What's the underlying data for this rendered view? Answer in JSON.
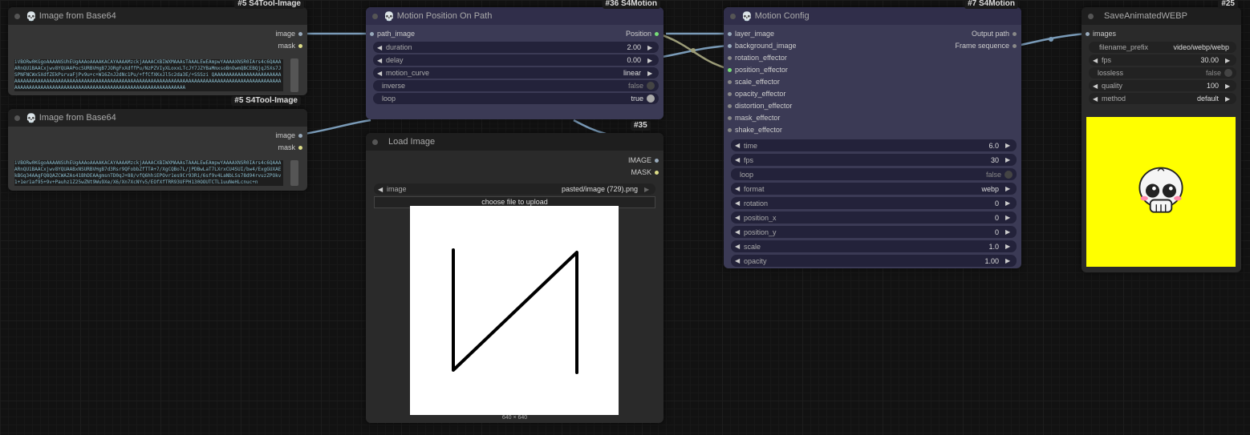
{
  "nodes": {
    "img64_a": {
      "title": "Image from Base64",
      "badge": "#5 S4Tool-Image",
      "outputs": [
        "image",
        "mask"
      ],
      "base64": "iVBORw0KGgoAAAANSUhEUgAAAoAAAAKACAYAAAAMzckjAAAACXBIWXMAAAsTAAALEwEAmpwYAAAAXNSR0IArs4c6QAAAARnQU1BAACxjwv8YQUAAPocSURBVHgB7JORgFxXdffPu/NzPZVIyXLoxxLTcJY7JZYBaMmxsoBnOwmQBCEBQjqJ5Xs7JSPNFNCWx5XdfZEkPsrvaFjPv9u+c+W16ZnJ2dNc1Pu/+ffCfXKxJl5c2da3E/+SSSzi QAAAAAAAAAAAAAAAAAAAAAAAAAAAAAAAAAAAAAAAAAAAAAAAAAAAAAAAAAAAAAAAAAAAAAAAAAAAAAAAAAAAAAAAAAAAAAAAAAAAAAAAAAAAAAAAAAAAAAAAAAAAAAAAAAAAAAAAAAAAAAAAAAAAAAAAAAAAAAAAAAAAAAAAAAAAAAA"
    },
    "img64_b": {
      "title": "Image from Base64",
      "badge": "#5 S4Tool-Image",
      "outputs": [
        "image",
        "mask"
      ],
      "base64": "iVBORw0KGgoAAAANSUhEUgAAAoAAAAKACAYAAAAMzckjAAAACXBIWXMAAAsTAAALEwEAmpwYAAAAXNSR0IArs4c6QAAAARnQU1BAACxjwv8YQUAABxNSURBVHgB7d3Rsr9QFobbZfTTA+7/XgCQBo7L/jPDBwLaT7LXrxCU4SUI/bw4/ExgGUXAEkBGq34AAgFQ8QAZCWAZAs41BhDEAAgmsnTD0qJ+88/vfQ6hhiEPOvr1es9Cr93Ri/6sf9v4LaNbLSs78d94rvuzZPOkv1+1er1af95+9v+Pauhz1Z25wZNt9Wu9Xe/X6/Xn7XcNYv5/EOfXfTRR93UFPH130OOUTCTL1uuNeHLcnuc+n"
    },
    "motion_path": {
      "title": "Motion Position On Path",
      "badge": "#36 S4Motion",
      "badge2": "#35",
      "inputs": [
        "path_image"
      ],
      "outputs": [
        "Position"
      ],
      "widgets": [
        {
          "label": "duration",
          "value": "2.00"
        },
        {
          "label": "delay",
          "value": "0.00"
        },
        {
          "label": "motion_curve",
          "value": "linear"
        },
        {
          "label": "inverse",
          "value": "false"
        },
        {
          "label": "loop",
          "value": "true"
        }
      ]
    },
    "load_image": {
      "title": "Load Image",
      "outputs": [
        "IMAGE",
        "MASK"
      ],
      "image_label": "image",
      "image_value": "pasted/image (729).png",
      "upload_label": "choose file to upload",
      "dims": "640 × 640"
    },
    "motion_config": {
      "title": "Motion Config",
      "badge": "#7 S4Motion",
      "inputs": [
        "layer_image",
        "background_image",
        "rotation_effector",
        "position_effector",
        "scale_effector",
        "opacity_effector",
        "distortion_effector",
        "mask_effector",
        "shake_effector"
      ],
      "outputs": [
        "Output path",
        "Frame sequence"
      ],
      "widgets": [
        {
          "label": "time",
          "value": "6.0"
        },
        {
          "label": "fps",
          "value": "30"
        },
        {
          "label": "loop",
          "value": "false"
        },
        {
          "label": "format",
          "value": "webp"
        },
        {
          "label": "rotation",
          "value": "0"
        },
        {
          "label": "position_x",
          "value": "0"
        },
        {
          "label": "position_y",
          "value": "0"
        },
        {
          "label": "scale",
          "value": "1.0"
        },
        {
          "label": "opacity",
          "value": "1.00"
        }
      ]
    },
    "save_webp": {
      "title": "SaveAnimatedWEBP",
      "badge": "#25",
      "inputs": [
        "images"
      ],
      "widgets": [
        {
          "label": "filename_prefix",
          "value": "video/webp/webp"
        },
        {
          "label": "fps",
          "value": "30.00"
        },
        {
          "label": "lossless",
          "value": "false"
        },
        {
          "label": "quality",
          "value": "100"
        },
        {
          "label": "method",
          "value": "default"
        }
      ],
      "preview_bg": "#ffff00"
    }
  },
  "colors": {
    "wire": "#7a9bb8",
    "wire_float": "#9c9c78",
    "canvas": "#121212"
  }
}
